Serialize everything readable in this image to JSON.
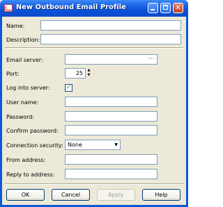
{
  "window": {
    "title": "New Outbound Email Profile",
    "title_icon": "email-profile-icon"
  },
  "titlebar_buttons": {
    "minimize_icon": "minimize-icon",
    "maximize_icon": "maximize-icon",
    "close_glyph": "✕"
  },
  "form": {
    "name_label": "Name:",
    "name_value": "",
    "description_label": "Description:",
    "description_value": "",
    "email_server_label": "Email server:",
    "email_server_value": "",
    "email_server_browse": "···",
    "port_label": "Port:",
    "port_value": "25",
    "log_into_server_label": "Log into server:",
    "log_into_server_checked": true,
    "check_glyph": "✓",
    "user_name_label": "User name:",
    "user_name_value": "",
    "password_label": "Password:",
    "password_value": "",
    "confirm_password_label": "Confirm password:",
    "confirm_password_value": "",
    "connection_security_label": "Connection security:",
    "connection_security_value": "None",
    "from_address_label": "From address:",
    "from_address_value": "",
    "reply_to_label": "Reply to address:",
    "reply_to_value": ""
  },
  "buttons": {
    "ok": "OK",
    "cancel": "Cancel",
    "apply": "Apply",
    "help": "Help"
  },
  "colors": {
    "titlebar": "#0a4fd6",
    "dialog_bg": "#ece9d8",
    "input_border": "#7f9db9",
    "checkmark": "#21a121"
  }
}
